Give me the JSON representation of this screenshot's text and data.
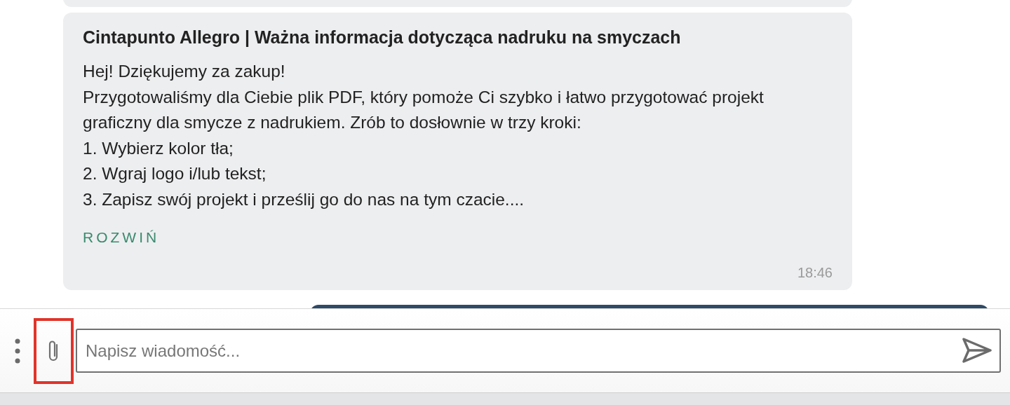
{
  "message": {
    "title": "Cintapunto Allegro | Ważna informacja dotycząca nadruku na smyczach",
    "paragraphs": [
      "Hej! Dziękujemy za zakup!",
      "Przygotowaliśmy dla Ciebie plik PDF, który pomoże Ci szybko i łatwo przygotować projekt graficzny dla smycze z nadrukiem. Zrób to dosłownie w trzy kroki:",
      "1. Wybierz kolor tła;",
      "2. Wgraj logo i/lub tekst;",
      "3. Zapisz swój projekt i prześlij go do nas na tym czacie...."
    ],
    "expand_link": "ROZWIŃ",
    "time": "18:46"
  },
  "composer": {
    "placeholder": "Napisz wiadomość...",
    "attach_highlighted": true
  }
}
